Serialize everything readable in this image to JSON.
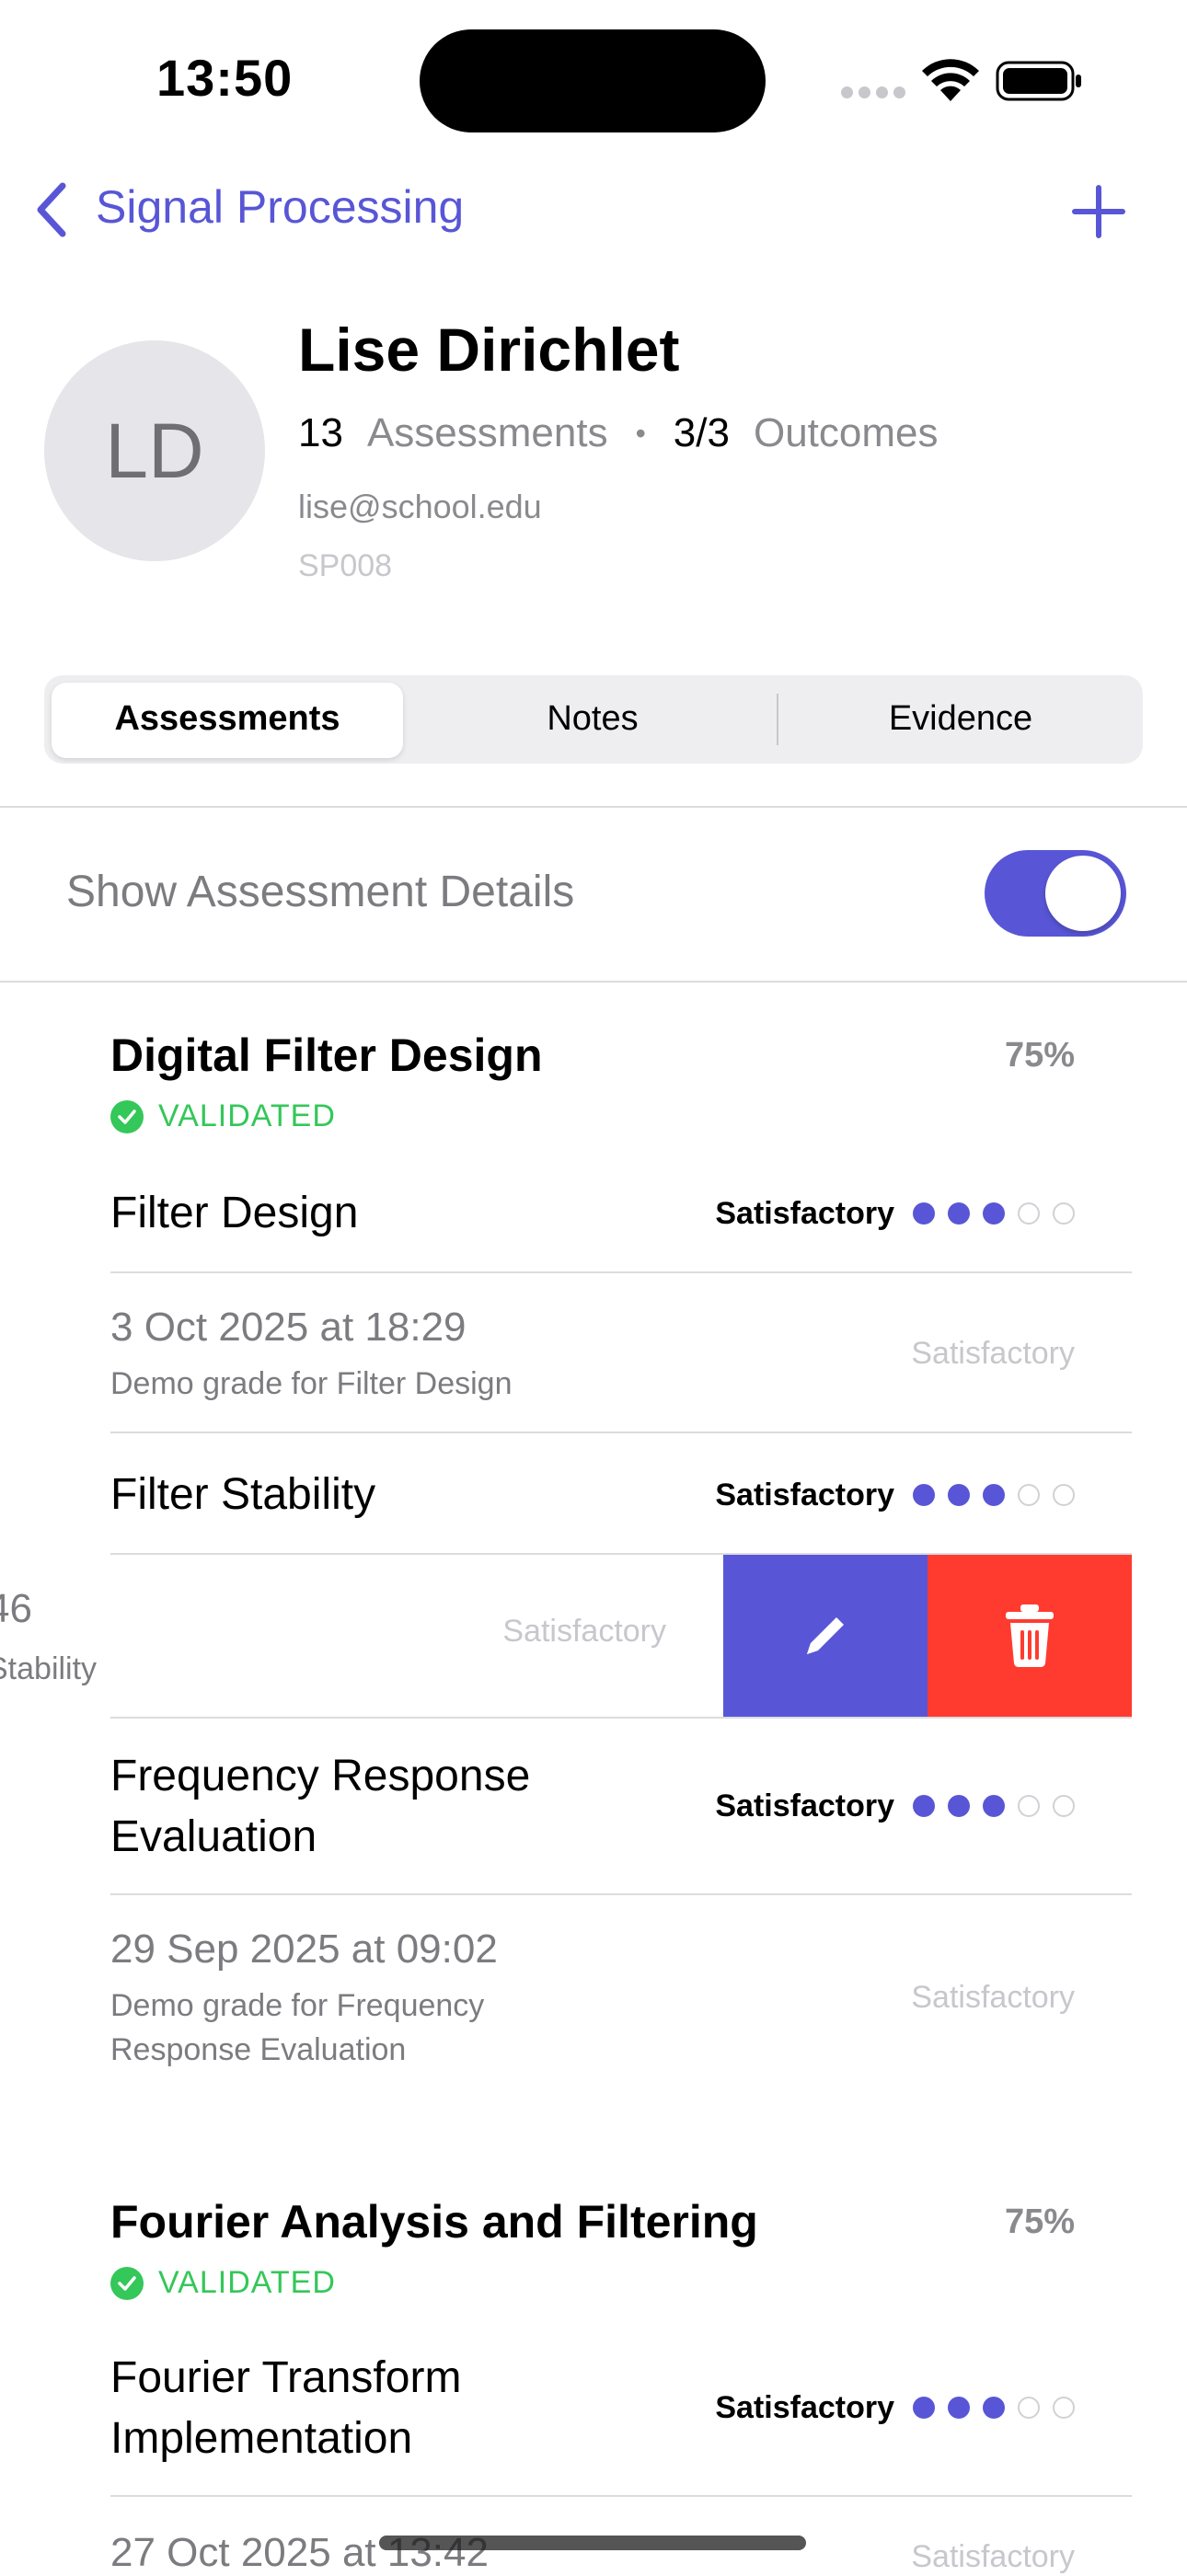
{
  "status_bar": {
    "time": "13:50"
  },
  "nav": {
    "back_label": "Signal Processing"
  },
  "profile": {
    "initials": "LD",
    "name": "Lise Dirichlet",
    "assessments_count": "13",
    "assessments_label": "Assessments",
    "separator": "•",
    "outcomes_count": "3/3",
    "outcomes_label": "Outcomes",
    "email": "lise@school.edu",
    "student_id": "SP008"
  },
  "tabs": [
    {
      "label": "Assessments",
      "selected": true
    },
    {
      "label": "Notes",
      "selected": false
    },
    {
      "label": "Evidence",
      "selected": false
    }
  ],
  "toggle": {
    "label": "Show Assessment Details",
    "on": true
  },
  "sections": [
    {
      "title": "Digital Filter Design",
      "percent": "75%",
      "status": "VALIDATED",
      "criteria": [
        {
          "name": "Filter Design",
          "grade": "Satisfactory",
          "level": 3,
          "max": 5,
          "entry": {
            "date": "3 Oct 2025 at 18:29",
            "note": "Demo grade for Filter Design",
            "grade": "Satisfactory"
          }
        },
        {
          "name": "Filter Stability",
          "grade": "Satisfactory",
          "level": 3,
          "max": 5,
          "entry": {
            "date": "46",
            "note": "Stability",
            "grade": "Satisfactory"
          }
        },
        {
          "name_line1": "Frequency Response",
          "name_line2": "Evaluation",
          "grade": "Satisfactory",
          "level": 3,
          "max": 5,
          "entry": {
            "date": "29 Sep 2025 at 09:02",
            "note_line1": "Demo grade for Frequency",
            "note_line2": "Response Evaluation",
            "grade": "Satisfactory"
          }
        }
      ]
    },
    {
      "title": "Fourier Analysis and Filtering",
      "percent": "75%",
      "status": "VALIDATED",
      "criteria": [
        {
          "name_line1": "Fourier Transform",
          "name_line2": "Implementation",
          "grade": "Satisfactory",
          "level": 3,
          "max": 5,
          "entry": {
            "date": "27 Oct 2025 at 13:42",
            "grade": "Satisfactory"
          }
        }
      ]
    }
  ],
  "colors": {
    "accent": "#5856d6",
    "destructive": "#ff3b30",
    "validated": "#34c759"
  },
  "icons": {
    "back": "chevron-left-icon",
    "add": "plus-icon",
    "edit": "pencil-icon",
    "delete": "trash-icon"
  }
}
